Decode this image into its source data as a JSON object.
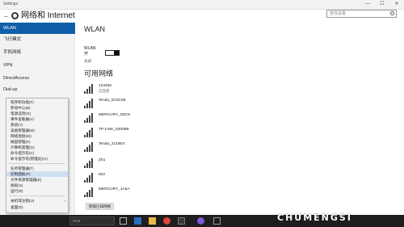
{
  "window": {
    "app_title": "Settings",
    "controls": {
      "minimize": "—",
      "maximize": "☐",
      "close": "✕"
    }
  },
  "header": {
    "title": "网络和 Internet",
    "search_placeholder": "查找设置"
  },
  "sidebar": {
    "items": [
      {
        "label": "WLAN",
        "active": true
      },
      {
        "label": "飞行模式",
        "active": false
      },
      {
        "label": "手机网络",
        "active": false
      },
      {
        "label": "VPN",
        "active": false
      },
      {
        "label": "DirectAccess",
        "active": false
      },
      {
        "label": "Dial-up",
        "active": false
      }
    ]
  },
  "context_menu": {
    "items": [
      {
        "label": "程序和功能(F)"
      },
      {
        "label": "移动中心(B)"
      },
      {
        "label": "电源选项(O)"
      },
      {
        "label": "事件查看器(V)"
      },
      {
        "label": "系统(Y)"
      },
      {
        "label": "设备管理器(M)"
      },
      {
        "label": "网络连接(W)"
      },
      {
        "label": "磁盘管理(K)"
      },
      {
        "label": "计算机管理(G)"
      },
      {
        "label": "命令提示符(C)"
      },
      {
        "label": "命令提示符(管理员)(A)"
      },
      {
        "label": "任务管理器(T)"
      },
      {
        "label": "控制面板(P)",
        "highlighted": true
      },
      {
        "label": "文件资源管理器(E)"
      },
      {
        "label": "搜索(S)"
      },
      {
        "label": "运行(R)"
      },
      {
        "label": "关机或注销(U)",
        "has_submenu": true
      },
      {
        "label": "桌面(D)"
      }
    ]
  },
  "main": {
    "title": "WLAN",
    "wlan_label": "WLAN",
    "wlan_status": "开",
    "advanced_link": "高级",
    "networks_heading": "可用网络",
    "networks": [
      {
        "name": "123456",
        "status": "已连接"
      },
      {
        "name": "Tenda_0C0C88",
        "status": ""
      },
      {
        "name": "MERCURY_0DC6",
        "status": ""
      },
      {
        "name": "TP-LINK_8200B8",
        "status": ""
      },
      {
        "name": "Tenda_2219E0",
        "status": ""
      },
      {
        "name": "Zhu",
        "status": ""
      },
      {
        "name": "602",
        "status": ""
      },
      {
        "name": "MERCURY_1A5A",
        "status": ""
      }
    ],
    "open_settings_button": "管理已知网络"
  },
  "taskbar": {
    "search_placeholder": "Web"
  },
  "watermark": {
    "text": "CHUMENGSI"
  },
  "colors": {
    "accent": "#0f5fa8",
    "taskbar": "#1e1e1e",
    "sidebar_bg": "#f2f2f2"
  }
}
